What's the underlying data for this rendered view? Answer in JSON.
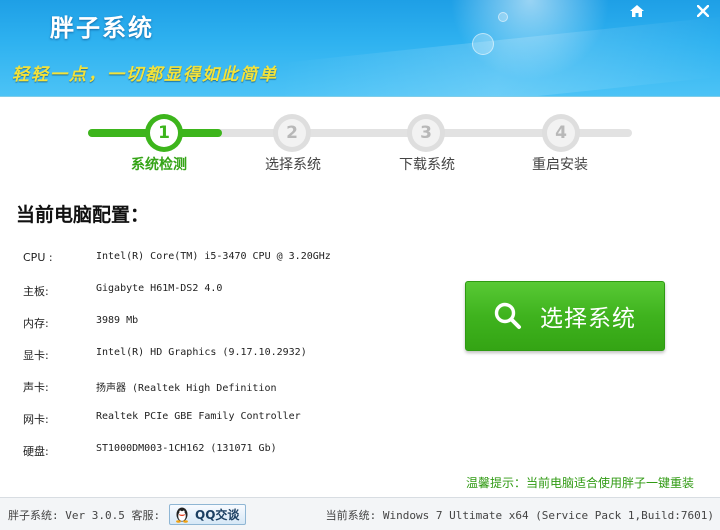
{
  "app": {
    "title": "胖子系统",
    "slogan": "轻轻一点，一切都显得如此简单"
  },
  "window_controls": {
    "home_icon": "home-icon",
    "close_icon": "close-icon"
  },
  "steps": [
    {
      "number": "1",
      "label": "系统检测",
      "active": true
    },
    {
      "number": "2",
      "label": "选择系统",
      "active": false
    },
    {
      "number": "3",
      "label": "下载系统",
      "active": false
    },
    {
      "number": "4",
      "label": "重启安装",
      "active": false
    }
  ],
  "config": {
    "title": "当前电脑配置：",
    "rows": [
      {
        "key": "CPU  :",
        "value": "Intel(R) Core(TM) i5-3470 CPU @ 3.20GHz"
      },
      {
        "key": "主板:",
        "value": "Gigabyte H61M-DS2 4.0"
      },
      {
        "key": "内存:",
        "value": "3989 Mb"
      },
      {
        "key": "显卡:",
        "value": "Intel(R) HD Graphics (9.17.10.2932)"
      },
      {
        "key": "声卡:",
        "value": "扬声器 (Realtek High Definition"
      },
      {
        "key": "网卡:",
        "value": "Realtek PCIe GBE Family Controller"
      },
      {
        "key": "硬盘:",
        "value": "ST1000DM003-1CH162 (131071 Gb)"
      }
    ]
  },
  "main_button": {
    "label": "选择系统",
    "icon": "search-icon"
  },
  "tip": "温馨提示：当前电脑适合使用胖子一键重装",
  "statusbar": {
    "version_text": "胖子系统: Ver 3.0.5 客服:",
    "qq_button_label": "QQ交谈",
    "qq_icon": "qq-penguin-icon",
    "current_system": "当前系统: Windows 7 Ultimate x64 (Service Pack 1,Build:7601)"
  },
  "colors": {
    "accent_green": "#3db51c",
    "header_blue": "#2fb2f0",
    "slogan_yellow": "#f3e23a"
  }
}
